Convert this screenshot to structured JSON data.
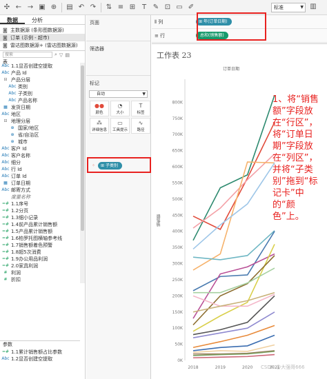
{
  "toolbar": {
    "icons": [
      "tableau-logo-icon",
      "back-icon",
      "forward-icon",
      "save-icon",
      "add-datasource-icon",
      "new-sheet-icon",
      "undo-icon",
      "redo-icon",
      "swap-icon",
      "sort-icon",
      "group-icon",
      "label-icon",
      "highlight-icon",
      "fit-icon",
      "present-icon",
      "pen-icon",
      "show-me-icon"
    ],
    "fit_select": "标准"
  },
  "left": {
    "tabs": [
      "数据",
      "分析"
    ],
    "datasources": [
      "主数据源 (条形图数据源)",
      "订单 (示例 - 超市)",
      "雷达图数据源+ (雷达图数据源)"
    ],
    "search_placeholder": "搜索",
    "tables_label": "表",
    "fields": [
      {
        "type": "Abc",
        "name": "1.1显否创建空提取",
        "indent": 1
      },
      {
        "type": "Abc",
        "name": "产品 Id",
        "indent": 1
      },
      {
        "type": "hier",
        "name": "产品分层",
        "indent": 1
      },
      {
        "type": "Abc",
        "name": "类别",
        "indent": 2
      },
      {
        "type": "Abc",
        "name": "子类别",
        "indent": 2
      },
      {
        "type": "Abc",
        "name": "产品名称",
        "indent": 2
      },
      {
        "type": "date",
        "name": "发货日期",
        "indent": 1
      },
      {
        "type": "Abc",
        "name": "地区",
        "indent": 1
      },
      {
        "type": "hier",
        "name": "地理分层",
        "indent": 1
      },
      {
        "type": "geo",
        "name": "国家/地区",
        "indent": 2
      },
      {
        "type": "geo",
        "name": "省/自治区",
        "indent": 2
      },
      {
        "type": "geo",
        "name": "城市",
        "indent": 2
      },
      {
        "type": "Abc",
        "name": "客户 Id",
        "indent": 1
      },
      {
        "type": "Abc",
        "name": "客户名称",
        "indent": 1
      },
      {
        "type": "Abc",
        "name": "细分",
        "indent": 1
      },
      {
        "type": "Abc",
        "name": "行 Id",
        "indent": 1
      },
      {
        "type": "Abc",
        "name": "订单 Id",
        "indent": 1
      },
      {
        "type": "date",
        "name": "订单日期",
        "indent": 1
      },
      {
        "type": "Abc",
        "name": "邮寄方式",
        "indent": 1
      },
      {
        "type": "",
        "name": "度量名称",
        "indent": 1,
        "italic": true
      },
      {
        "type": "=#",
        "name": "1.1序号",
        "indent": 1
      },
      {
        "type": "=#",
        "name": "1.2分页",
        "indent": 1
      },
      {
        "type": "=#",
        "name": "1.3细小记录",
        "indent": 1
      },
      {
        "type": "=#",
        "name": "1.4前产品累计销售额",
        "indent": 1
      },
      {
        "type": "=#",
        "name": "1.5产品累计销售额",
        "indent": 1
      },
      {
        "type": "=#",
        "name": "1.6柏罗托图横轴参考线",
        "indent": 1
      },
      {
        "type": "=#",
        "name": "1.7销售额着色预警",
        "indent": 1
      },
      {
        "type": "=#",
        "name": "1.8超5次消费",
        "indent": 1
      },
      {
        "type": "=#",
        "name": "1.9办公用品利润",
        "indent": 1
      },
      {
        "type": "=#",
        "name": "2.0家具利润",
        "indent": 1
      },
      {
        "type": "#",
        "name": "利润",
        "indent": 1
      },
      {
        "type": "#",
        "name": "折扣",
        "indent": 1
      }
    ],
    "params_label": "参数",
    "params": [
      {
        "type": "=#",
        "name": "1.1累计销售额占比参数"
      },
      {
        "type": "Abc",
        "name": "1.2显否创建空提取"
      }
    ]
  },
  "mid": {
    "pages_title": "页面",
    "filters_title": "筛选器",
    "marks_title": "标记",
    "mark_type": "自动",
    "mark_buttons": [
      {
        "icon": "color-icon",
        "label": "颜色",
        "glyph": "●●"
      },
      {
        "icon": "size-icon",
        "label": "大小",
        "glyph": "◔"
      },
      {
        "icon": "label-icon",
        "label": "标签",
        "glyph": "T"
      },
      {
        "icon": "detail-icon",
        "label": "详细信息",
        "glyph": "⁂"
      },
      {
        "icon": "tooltip-icon",
        "label": "工具提示",
        "glyph": "▭"
      },
      {
        "icon": "path-icon",
        "label": "路径",
        "glyph": "∿"
      }
    ],
    "color_pill": "子类别"
  },
  "shelves": {
    "columns_label": "列",
    "rows_label": "行",
    "columns_pill": "年(订单日期)",
    "rows_pill": "总和(销售额)"
  },
  "sheet": {
    "title": "工作表 23",
    "column_header": "订单日期",
    "y_title": "销售额"
  },
  "chart_data": {
    "type": "line",
    "x": [
      "2018",
      "2019",
      "2020",
      "2021"
    ],
    "ylim": [
      0,
      850000
    ],
    "yticks": [
      "0K",
      "50K",
      "100K",
      "150K",
      "200K",
      "250K",
      "300K",
      "350K",
      "400K",
      "450K",
      "500K",
      "550K",
      "600K",
      "650K",
      "700K",
      "750K",
      "800K"
    ],
    "xlabel": "",
    "ylabel": "销售额",
    "series": [
      {
        "color": "#2d8a6f",
        "values": [
          372000,
          535000,
          575000,
          822000
        ]
      },
      {
        "color": "#e14b3b",
        "values": [
          447000,
          406000,
          565000,
          738000
        ]
      },
      {
        "color": "#f4a0a6",
        "values": [
          410000,
          472000,
          560000,
          640000
        ]
      },
      {
        "color": "#f6b26b",
        "values": [
          280000,
          330000,
          615000,
          612000
        ]
      },
      {
        "color": "#9ec6e8",
        "values": [
          345000,
          420000,
          485000,
          612000
        ]
      },
      {
        "color": "#6fb7c4",
        "values": [
          320000,
          312000,
          325000,
          402000
        ]
      },
      {
        "color": "#4a7bb0",
        "values": [
          216000,
          260000,
          265000,
          400000
        ]
      },
      {
        "color": "#b84f96",
        "values": [
          130000,
          268000,
          290000,
          330000
        ]
      },
      {
        "color": "#d9cf4a",
        "values": [
          90000,
          138000,
          180000,
          360000
        ]
      },
      {
        "color": "#8c6d2f",
        "values": [
          110000,
          200000,
          238000,
          325000
        ]
      },
      {
        "color": "#a6d0a0",
        "values": [
          210000,
          210000,
          240000,
          286000
        ]
      },
      {
        "color": "#f4b6c9",
        "values": [
          200000,
          168000,
          168000,
          205000
        ]
      },
      {
        "color": "#c9b27a",
        "values": [
          150000,
          168000,
          185000,
          210000
        ]
      },
      {
        "color": "#555555",
        "values": [
          80000,
          95000,
          118000,
          200000
        ]
      },
      {
        "color": "#8f8ad0",
        "values": [
          70000,
          85000,
          100000,
          150000
        ]
      },
      {
        "color": "#e88a3a",
        "values": [
          40000,
          58000,
          78000,
          108000
        ]
      },
      {
        "color": "#3a6cb0",
        "values": [
          30000,
          40000,
          45000,
          78000
        ]
      },
      {
        "color": "#f0d0a0",
        "values": [
          25000,
          30000,
          28000,
          48000
        ]
      },
      {
        "color": "#9a7a5a",
        "values": [
          20000,
          20000,
          22000,
          30000
        ]
      },
      {
        "color": "#7aa060",
        "values": [
          15000,
          18000,
          20000,
          28000
        ]
      },
      {
        "color": "#cc6677",
        "values": [
          8000,
          10000,
          12000,
          18000
        ]
      }
    ]
  },
  "annotation": "1、将“销售额”字段放在“行区”，将“订单日期”字段放在“列区”，并将“子类别”拖到“标记卡”中的“颜色”上。",
  "watermark": "CSDN @大强哥666"
}
